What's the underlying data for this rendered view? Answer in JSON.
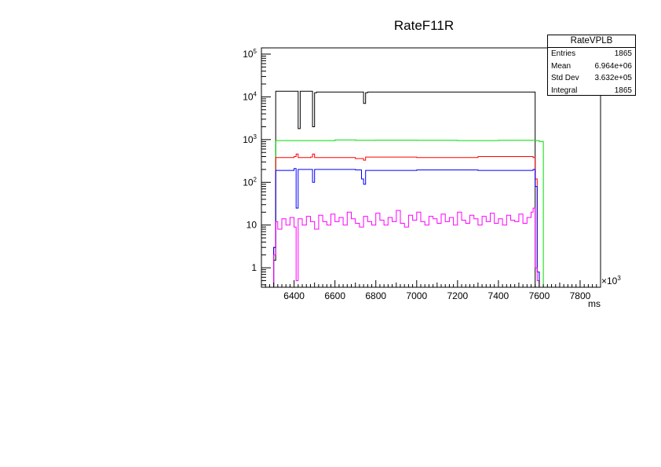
{
  "chart_data": {
    "type": "line",
    "title": "RateF11R",
    "xlabel": "ms",
    "x_multiplier_label": "×10",
    "x_multiplier_exp": "3",
    "xlim": [
      6240,
      7900
    ],
    "ylim": [
      0.35,
      140000
    ],
    "y_scale": "log",
    "x_ticks": [
      "6400",
      "6600",
      "6800",
      "7000",
      "7200",
      "7400",
      "7600",
      "7800"
    ],
    "y_ticks": [
      {
        "base": "1",
        "exp": ""
      },
      {
        "base": "10",
        "exp": ""
      },
      {
        "base": "10",
        "exp": "2"
      },
      {
        "base": "10",
        "exp": "3"
      },
      {
        "base": "10",
        "exp": "4"
      },
      {
        "base": "10",
        "exp": "5"
      }
    ],
    "grid": false,
    "stats": {
      "name": "RateVPLB",
      "rows": [
        {
          "label": "Entries",
          "value": "1865"
        },
        {
          "label": "Mean",
          "value": "6.964e+06"
        },
        {
          "label": "Std Dev",
          "value": "3.632e+05"
        },
        {
          "label": "Integral",
          "value": "1865"
        }
      ]
    },
    "series": [
      {
        "color": "#000000",
        "x": [
          6240,
          6300,
          6310,
          6400,
          6420,
          6430,
          6480,
          6490,
          6500,
          6510,
          6730,
          6740,
          6750,
          6760,
          7570,
          7580
        ],
        "y": [
          0.35,
          1.5,
          13500,
          13500,
          1800,
          13500,
          13500,
          2000,
          12500,
          13000,
          13000,
          7000,
          12500,
          13000,
          13000,
          0.35
        ]
      },
      {
        "color": "#00dd00",
        "x": [
          6240,
          6300,
          6310,
          6600,
          6700,
          6800,
          7000,
          7200,
          7400,
          7580,
          7600,
          7620
        ],
        "y": [
          0.35,
          3,
          950,
          980,
          960,
          970,
          960,
          950,
          960,
          950,
          900,
          0.35
        ]
      },
      {
        "color": "#ff0000",
        "x": [
          6240,
          6300,
          6310,
          6400,
          6410,
          6420,
          6480,
          6490,
          6500,
          6700,
          6740,
          6750,
          7000,
          7300,
          7570,
          7580,
          7590,
          7600
        ],
        "y": [
          0.35,
          3,
          380,
          400,
          460,
          380,
          390,
          460,
          380,
          360,
          330,
          390,
          380,
          400,
          380,
          120,
          0.8,
          0.35
        ]
      },
      {
        "color": "#0000ff",
        "x": [
          6240,
          6300,
          6310,
          6400,
          6410,
          6420,
          6480,
          6490,
          6500,
          6700,
          6730,
          6740,
          6750,
          7000,
          7300,
          7570,
          7580,
          7590,
          7600
        ],
        "y": [
          0.35,
          3,
          190,
          210,
          25,
          200,
          200,
          100,
          200,
          195,
          120,
          90,
          190,
          195,
          190,
          200,
          80,
          0.8,
          0.35
        ]
      },
      {
        "color": "#ff00ff",
        "x": [
          6240,
          6300,
          6310,
          6320,
          6340,
          6360,
          6380,
          6400,
          6410,
          6420,
          6440,
          6460,
          6480,
          6500,
          6520,
          6540,
          6560,
          6580,
          6600,
          6620,
          6640,
          6660,
          6680,
          6700,
          6720,
          6740,
          6760,
          6780,
          6800,
          6820,
          6840,
          6860,
          6880,
          6900,
          6920,
          6940,
          6960,
          6980,
          7000,
          7020,
          7040,
          7060,
          7080,
          7100,
          7120,
          7140,
          7160,
          7180,
          7200,
          7220,
          7240,
          7260,
          7280,
          7300,
          7320,
          7340,
          7360,
          7380,
          7400,
          7420,
          7440,
          7460,
          7480,
          7500,
          7520,
          7540,
          7560,
          7570,
          7580,
          7590,
          7600
        ],
        "y": [
          0.35,
          2,
          12,
          8,
          14,
          10,
          15,
          9,
          0.5,
          14,
          10,
          16,
          12,
          8,
          17,
          12,
          10,
          18,
          12,
          15,
          10,
          20,
          14,
          11,
          9,
          16,
          12,
          10,
          19,
          13,
          10,
          15,
          12,
          22,
          11,
          9,
          17,
          13,
          20,
          12,
          10,
          16,
          14,
          11,
          18,
          12,
          15,
          10,
          20,
          13,
          11,
          17,
          14,
          10,
          16,
          12,
          19,
          11,
          14,
          10,
          17,
          13,
          12,
          18,
          11,
          15,
          20,
          25,
          1,
          0.5,
          0.35
        ]
      }
    ]
  }
}
